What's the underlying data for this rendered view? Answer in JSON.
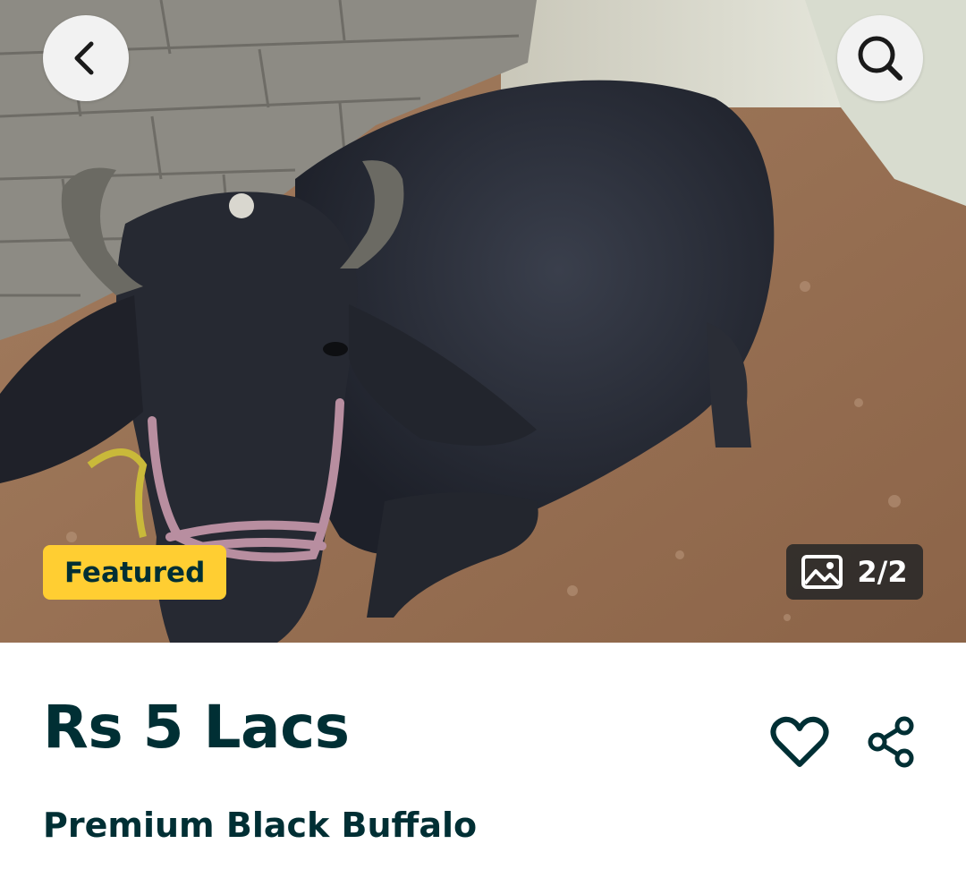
{
  "listing": {
    "badge": "Featured",
    "image_counter": "2/2",
    "price": "Rs 5 Lacs",
    "title": "Premium Black Buffalo"
  },
  "icons": {
    "back": "chevron-left-icon",
    "search": "search-icon",
    "gallery": "image-icon",
    "favorite": "heart-icon",
    "share": "share-icon"
  },
  "colors": {
    "text_primary": "#002f34",
    "badge_bg": "#ffce32"
  }
}
